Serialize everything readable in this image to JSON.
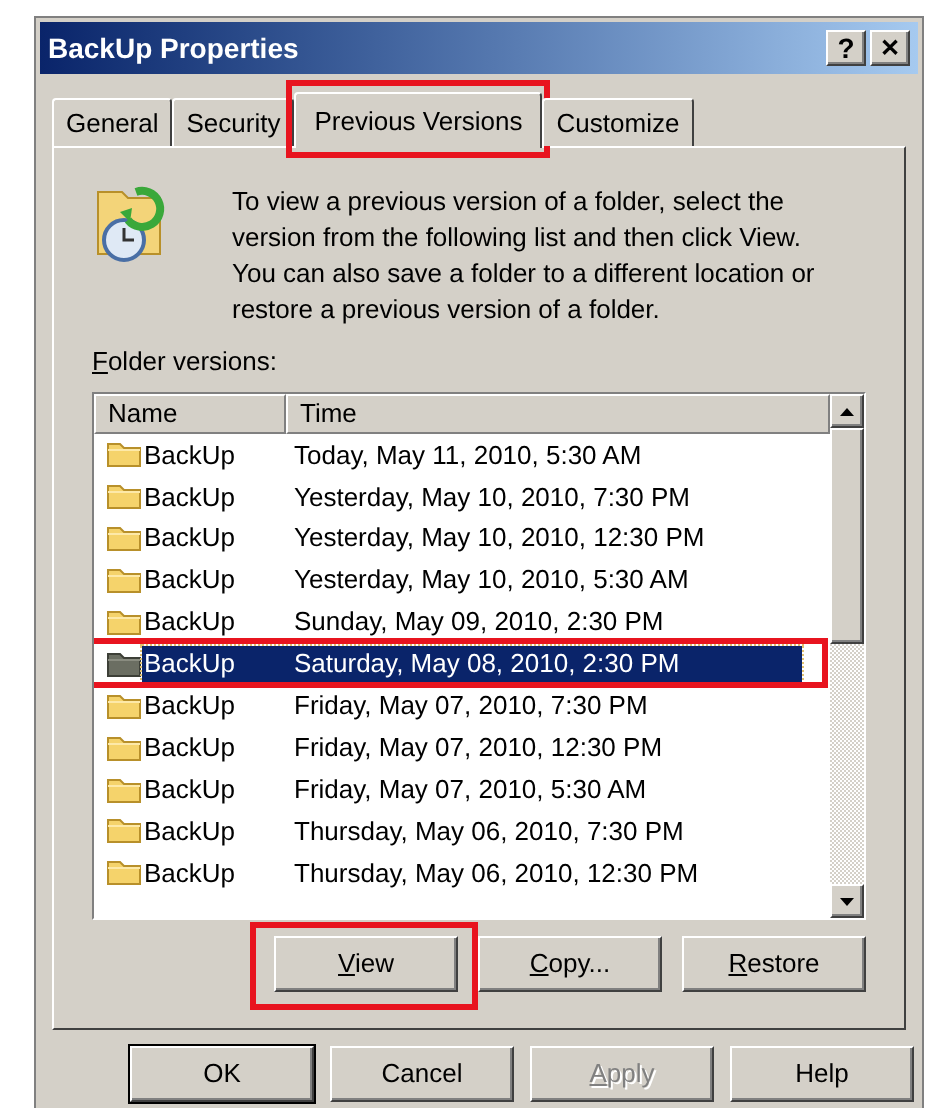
{
  "window": {
    "title": "BackUp Properties",
    "help_button": "?",
    "close_button": "✕"
  },
  "tabs": [
    {
      "label": "General",
      "selected": false
    },
    {
      "label": "Security",
      "selected": false
    },
    {
      "label": "Previous Versions",
      "selected": true,
      "highlighted": true
    },
    {
      "label": "Customize",
      "selected": false
    }
  ],
  "intro": "To view a previous version of a folder, select the version from the following list and then click View. You can also save a folder to a different location or restore a previous version of a folder.",
  "list_label": {
    "text": "Folder versions:",
    "underline_first": true
  },
  "table": {
    "columns": [
      "Name",
      "Time"
    ],
    "rows": [
      {
        "name": "BackUp",
        "time": "Today, May 11, 2010, 5:30 AM",
        "selected": false
      },
      {
        "name": "BackUp",
        "time": "Yesterday, May 10, 2010, 7:30 PM",
        "selected": false
      },
      {
        "name": "BackUp",
        "time": "Yesterday, May 10, 2010, 12:30 PM",
        "selected": false
      },
      {
        "name": "BackUp",
        "time": "Yesterday, May 10, 2010, 5:30 AM",
        "selected": false
      },
      {
        "name": "BackUp",
        "time": "Sunday, May 09, 2010, 2:30 PM",
        "selected": false
      },
      {
        "name": "BackUp",
        "time": "Saturday, May 08, 2010, 2:30 PM",
        "selected": true,
        "highlighted": true
      },
      {
        "name": "BackUp",
        "time": "Friday, May 07, 2010, 7:30 PM",
        "selected": false
      },
      {
        "name": "BackUp",
        "time": "Friday, May 07, 2010, 12:30 PM",
        "selected": false
      },
      {
        "name": "BackUp",
        "time": "Friday, May 07, 2010, 5:30 AM",
        "selected": false
      },
      {
        "name": "BackUp",
        "time": "Thursday, May 06, 2010, 7:30 PM",
        "selected": false
      },
      {
        "name": "BackUp",
        "time": "Thursday, May 06, 2010, 12:30 PM",
        "selected": false
      }
    ]
  },
  "actions": [
    {
      "label": "View",
      "underline_first": true,
      "highlighted": true
    },
    {
      "label": "Copy...",
      "underline_first": true,
      "highlighted": false
    },
    {
      "label": "Restore",
      "underline_first": true,
      "highlighted": false
    }
  ],
  "buttons": [
    {
      "label": "OK",
      "underline_first": false,
      "disabled": false,
      "default": true
    },
    {
      "label": "Cancel",
      "underline_first": false,
      "disabled": false,
      "default": false
    },
    {
      "label": "Apply",
      "underline_first": true,
      "disabled": true,
      "default": false
    },
    {
      "label": "Help",
      "underline_first": false,
      "disabled": false,
      "default": false
    }
  ]
}
